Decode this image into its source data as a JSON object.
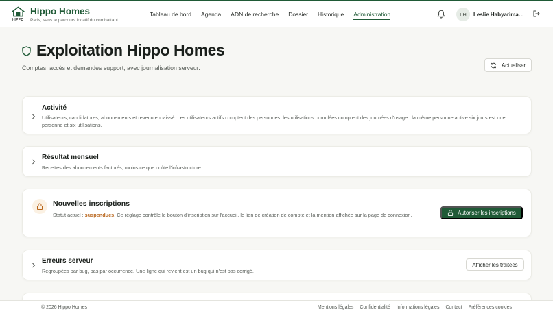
{
  "brand": {
    "name": "Hippo Homes",
    "tagline": "Paris, sans le parcours locatif du combattant.",
    "logo_text": "HIPPO"
  },
  "nav": {
    "items": [
      {
        "label": "Tableau de bord",
        "active": false
      },
      {
        "label": "Agenda",
        "active": false
      },
      {
        "label": "ADN de recherche",
        "active": false
      },
      {
        "label": "Dossier",
        "active": false
      },
      {
        "label": "Historique",
        "active": false
      },
      {
        "label": "Administration",
        "active": true
      }
    ]
  },
  "user": {
    "initials": "LH",
    "name": "Leslie Habyarima…"
  },
  "icons": {
    "notifications": "bell-icon",
    "logout": "logout-icon",
    "page": "shield-icon",
    "refresh": "refresh-icon",
    "lock": "lock-icon",
    "chevron": "chevron-right-icon"
  },
  "page": {
    "title": "Exploitation Hippo Homes",
    "subtitle": "Comptes, accès et demandes support, avec journalisation serveur.",
    "refresh_label": "Actualiser"
  },
  "sections": {
    "activity": {
      "title": "Activité",
      "description": "Utilisateurs, candidatures, abonnements et revenu encaissé. Les utilisateurs actifs comptent des personnes, les utilisations cumulées comptent des journées d'usage : la même personne active six jours est une personne et six utilisations."
    },
    "monthly": {
      "title": "Résultat mensuel",
      "description": "Recettes des abonnements facturés, moins ce que coûte l'infrastructure."
    },
    "signups": {
      "title": "Nouvelles inscriptions",
      "status_prefix": "Statut actuel : ",
      "status_value": "suspendues",
      "status_suffix": ". Ce réglage contrôle le bouton d'inscription sur l'accueil, le lien de création de compte et la mention affichée sur la page de connexion.",
      "button_label": "Autoriser les inscriptions"
    },
    "errors": {
      "title": "Erreurs serveur",
      "description": "Regroupées par bug, pas par occurrence. Une ligne qui revient est un bug qui n'est pas corrigé.",
      "button_label": "Afficher les traitées"
    }
  },
  "footer": {
    "copyright": "© 2026 Hippo Homes",
    "links": [
      "Mentions légales",
      "Confidentialité",
      "Informations légales",
      "Contact",
      "Préférences cookies"
    ]
  },
  "colors": {
    "brand": "#1f5a36",
    "status": "#b8651b",
    "background": "#f7f7f4"
  }
}
